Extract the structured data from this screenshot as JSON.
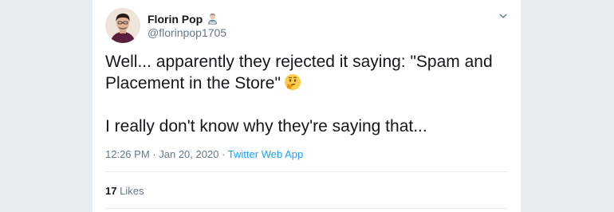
{
  "author": {
    "display_name": "Florin Pop",
    "badge_emoji": "technologist-emoji-icon",
    "handle": "@florinpop1705",
    "avatar": "profile-photo"
  },
  "tweet": {
    "line1": "Well... apparently they rejected it saying: \"Spam and Placement in the Store\"",
    "line1_emoji": "thinking-face-emoji-icon",
    "line2": "I really don't know why they're saying that..."
  },
  "meta": {
    "time": "12:26 PM",
    "date": "Jan 20, 2020",
    "separator": "·",
    "source": "Twitter Web App"
  },
  "stats": {
    "likes_count": "17",
    "likes_label": "Likes"
  },
  "colors": {
    "accent": "#1da1f2",
    "text": "#14171a",
    "muted": "#657786",
    "border": "#e6ecf0"
  }
}
